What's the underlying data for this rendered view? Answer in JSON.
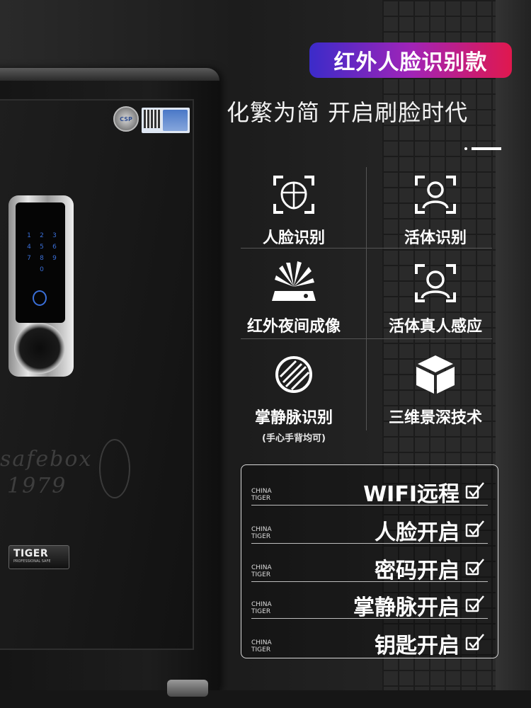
{
  "banner": {
    "title": "红外人脸识别款"
  },
  "slogan": "化繁为简 开启刷脸时代",
  "features": [
    {
      "label": "人脸识别",
      "icon": "face-scan-icon"
    },
    {
      "label": "活体识别",
      "icon": "person-scan-icon"
    },
    {
      "label": "红外夜间成像",
      "icon": "infrared-burst-icon"
    },
    {
      "label": "活体真人感应",
      "icon": "person-detect-icon"
    },
    {
      "label": "掌静脉识别",
      "sub": "(手心手背均可)",
      "icon": "palm-vein-icon"
    },
    {
      "label": "三维景深技术",
      "icon": "3d-cube-icon"
    }
  ],
  "methods": [
    {
      "brand_line1": "CHINA",
      "brand_line2": "TIGER",
      "text": "WIFI远程"
    },
    {
      "brand_line1": "CHINA",
      "brand_line2": "TIGER",
      "text": "人脸开启"
    },
    {
      "brand_line1": "CHINA",
      "brand_line2": "TIGER",
      "text": "密码开启"
    },
    {
      "brand_line1": "CHINA",
      "brand_line2": "TIGER",
      "text": "掌静脉开启"
    },
    {
      "brand_line1": "CHINA",
      "brand_line2": "TIGER",
      "text": "钥匙开启"
    }
  ],
  "safe": {
    "keypad_keys": [
      "1",
      "2",
      "3",
      "4",
      "5",
      "6",
      "7",
      "8",
      "9",
      "",
      "0",
      ""
    ],
    "script_line1": "safebox",
    "script_line2": "1979",
    "brand_name": "TIGER",
    "brand_tagline": "PROFESSIONAL SAFE",
    "keyhole_mark": "CSP"
  }
}
